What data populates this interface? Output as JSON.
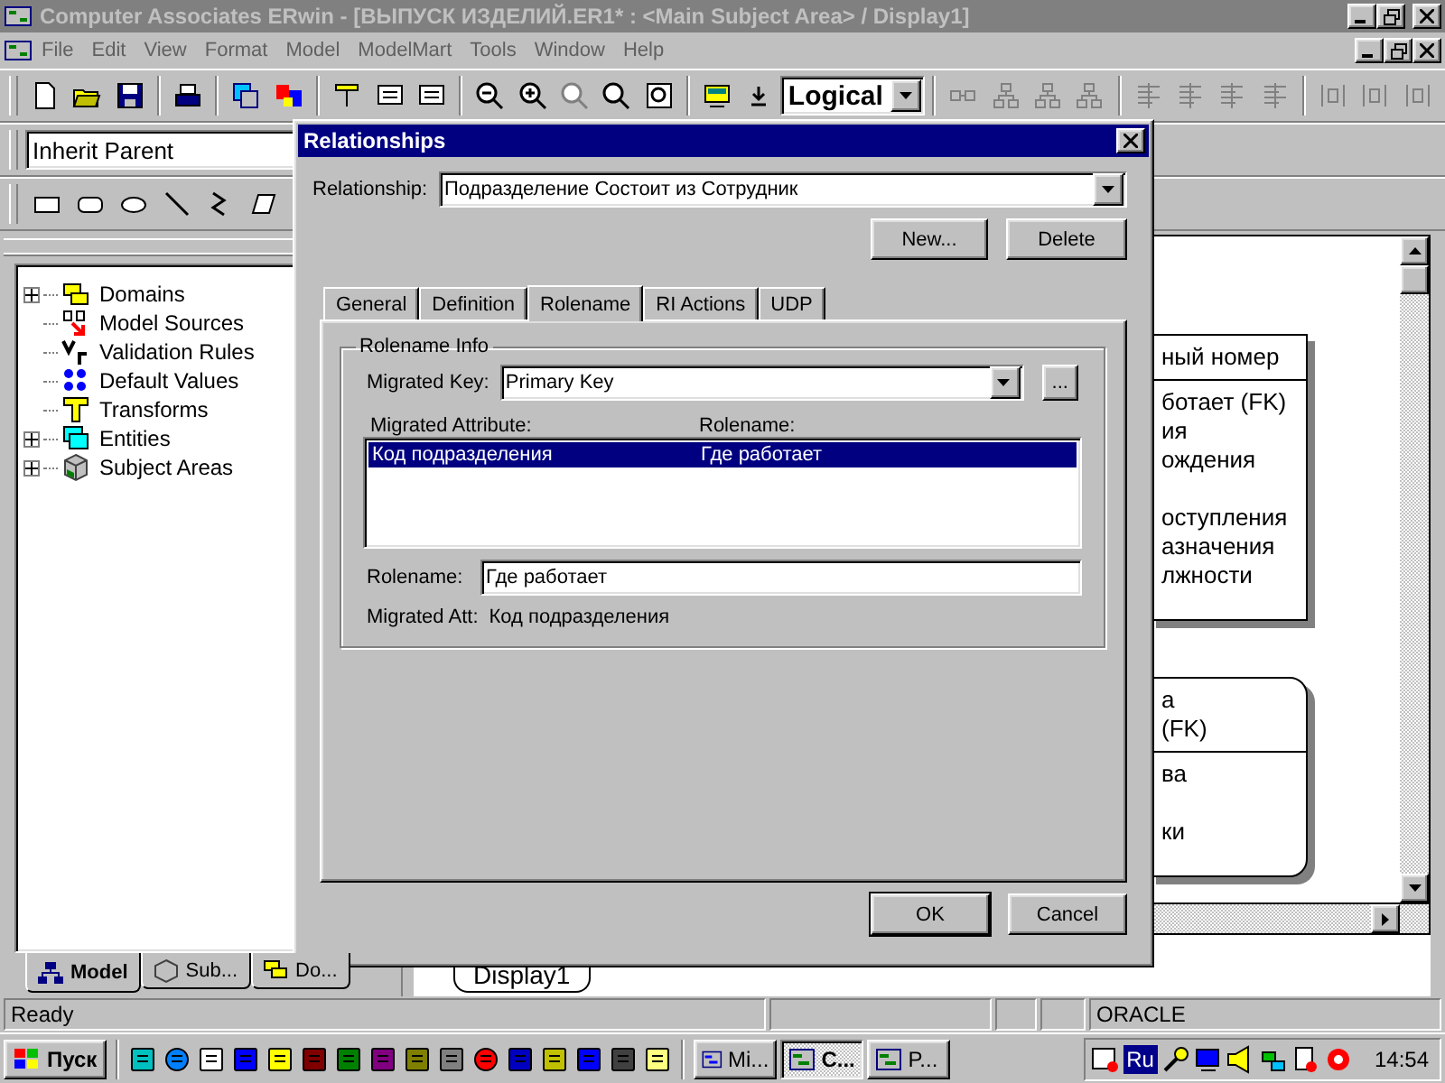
{
  "window": {
    "title": "Computer Associates ERwin - [ВЫПУСК ИЗДЕЛИЙ.ER1* : <Main Subject Area> / Display1]"
  },
  "menu": [
    "File",
    "Edit",
    "View",
    "Format",
    "Model",
    "ModelMart",
    "Tools",
    "Window",
    "Help"
  ],
  "toolbar": {
    "view_mode": "Logical"
  },
  "inherit_combo": {
    "value": "Inherit Parent"
  },
  "tree": [
    {
      "label": "Domains",
      "kind": "group"
    },
    {
      "label": "Model Sources",
      "kind": "leaf"
    },
    {
      "label": "Validation Rules",
      "kind": "leaf"
    },
    {
      "label": "Default Values",
      "kind": "leaf"
    },
    {
      "label": "Transforms",
      "kind": "leaf"
    },
    {
      "label": "Entities",
      "kind": "group"
    },
    {
      "label": "Subject Areas",
      "kind": "group"
    }
  ],
  "panel_tabs": [
    {
      "label": "Model",
      "selected": true
    },
    {
      "label": "Sub...",
      "selected": false
    },
    {
      "label": "Do...",
      "selected": false
    }
  ],
  "canvas": {
    "entities": [
      {
        "kind": "independent",
        "key_attributes": [
          "ный номер"
        ],
        "attribute_groups": [
          [
            "ботает (FK)",
            "ия",
            "ождения"
          ],
          [
            "оступления",
            "азначения",
            "лжности"
          ]
        ]
      },
      {
        "kind": "dependent",
        "key_attributes": [
          "а",
          "(FK)"
        ],
        "attribute_groups": [
          [
            "ва"
          ],
          [
            "ки"
          ]
        ]
      }
    ],
    "tab": "Display1"
  },
  "dialog": {
    "title": "Relationships",
    "relationship_label": "Relationship:",
    "relationship": "Подразделение Состоит из Сотрудник",
    "top_buttons": [
      "New...",
      "Delete"
    ],
    "tabs": [
      {
        "label": "General",
        "selected": false
      },
      {
        "label": "Definition",
        "selected": false
      },
      {
        "label": "Rolename",
        "selected": true
      },
      {
        "label": "RI Actions",
        "selected": false
      },
      {
        "label": "UDP",
        "selected": false
      }
    ],
    "group_title": "Rolename Info",
    "migrated_key_label": "Migrated Key:",
    "migrated_key": "Primary Key",
    "browse_button": "...",
    "columns": [
      "Migrated Attribute:",
      "Rolename:"
    ],
    "rows": [
      {
        "cells": [
          "Код подразделения",
          "Где работает"
        ],
        "selected": true
      }
    ],
    "rolename_label": "Rolename:",
    "rolename": "Где работает",
    "migrated_att_label": "Migrated Att:",
    "migrated_att": "Код подразделения",
    "bottom_buttons": [
      {
        "label": "OK",
        "default": true
      },
      {
        "label": "Cancel",
        "default": false
      }
    ]
  },
  "status_bar": {
    "text": "Ready",
    "database": "ORACLE"
  },
  "taskbar": {
    "start": "Пуск",
    "tasks": [
      {
        "label": "Mi...",
        "selected": false
      },
      {
        "label": "C...",
        "selected": true
      },
      {
        "label": "P...",
        "selected": false
      }
    ],
    "language": "Ru",
    "clock": "14:54"
  }
}
